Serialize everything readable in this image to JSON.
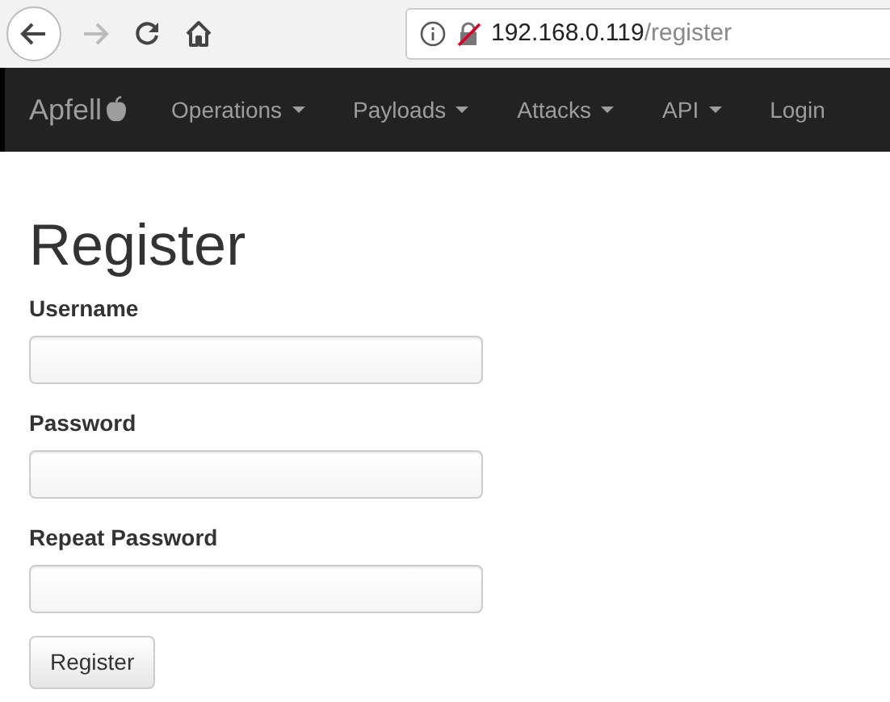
{
  "browser": {
    "back_enabled": true,
    "forward_enabled": false,
    "url_host": "192.168.0.119",
    "url_path": "/register",
    "insecure": true
  },
  "navbar": {
    "brand": "Apfell",
    "items": [
      {
        "label": "Operations",
        "dropdown": true
      },
      {
        "label": "Payloads",
        "dropdown": true
      },
      {
        "label": "Attacks",
        "dropdown": true
      },
      {
        "label": "API",
        "dropdown": true
      },
      {
        "label": "Login",
        "dropdown": false
      }
    ]
  },
  "heading": "Register",
  "fields": [
    {
      "label": "Username"
    },
    {
      "label": "Password"
    },
    {
      "label": "Repeat Password"
    }
  ],
  "submit": "Register"
}
